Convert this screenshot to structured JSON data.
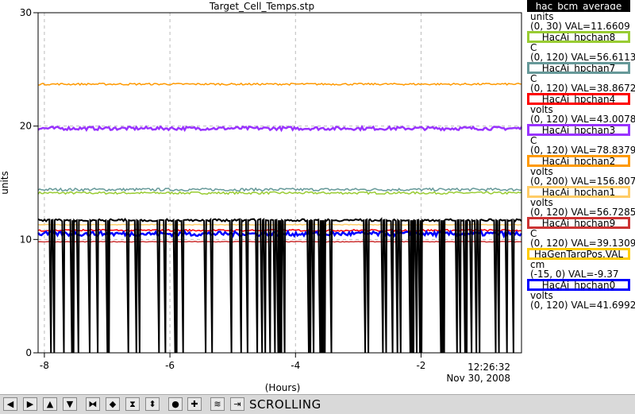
{
  "chart_data": {
    "type": "line",
    "title": "Target_Cell_Temps.stp",
    "xlabel": "(Hours)",
    "ylabel": "units",
    "xlim": [
      -8.1,
      -0.4
    ],
    "ylim": [
      0,
      30
    ],
    "xticks": [
      -8,
      -6,
      -4,
      -2
    ],
    "yticks": [
      0,
      10,
      20,
      30
    ],
    "time_label": [
      "12:26:32",
      "Nov 30, 2008"
    ],
    "grid": true,
    "legend_position": "right",
    "series": [
      {
        "name": "hac_bcm_average",
        "unit": "units",
        "range": "(0, 30)",
        "value": "VAL=11.6609",
        "color": "#000000",
        "y": 11.7,
        "noise": 0.1,
        "kind": "pulse"
      },
      {
        "name": "HacAi_hpchan8",
        "unit": "C",
        "range": "(0, 120)",
        "value": "VAL=56.6113",
        "color": "#99cc33",
        "y": 14.1,
        "noise": 0.1
      },
      {
        "name": "HacAi_hpchan7",
        "unit": "C",
        "range": "(0, 120)",
        "value": "VAL=38.8672",
        "color": "#669999",
        "y": 14.4,
        "noise": 0.12
      },
      {
        "name": "HacAi_hpchan4",
        "unit": "volts",
        "range": "(0, 120)",
        "value": "VAL=43.0078",
        "color": "#ff0000",
        "y": 10.8,
        "noise": 0.08
      },
      {
        "name": "HacAi_hpchan3",
        "unit": "C",
        "range": "(0, 120)",
        "value": "VAL=78.8379",
        "color": "#9933ff",
        "y": 19.8,
        "noise": 0.15
      },
      {
        "name": "HacAi_hpchan2",
        "unit": "volts",
        "range": "(0, 200)",
        "value": "VAL=156.807",
        "color": "#ff9900",
        "y": 23.7,
        "noise": 0.08
      },
      {
        "name": "HacAi_hpchan1",
        "unit": "volts",
        "range": "(0, 120)",
        "value": "VAL=56.7285",
        "color": "#ffcc66",
        "y": 11.3,
        "noise": 0.03
      },
      {
        "name": "HacAi_hpchan9",
        "unit": "C",
        "range": "(0, 120)",
        "value": "VAL=39.1309",
        "color": "#cc3333",
        "y": 9.8,
        "noise": 0.03
      },
      {
        "name": "HaGenTargPos.VAL",
        "unit": "cm",
        "range": "(-15, 0)",
        "value": "VAL=-9.37",
        "color": "#ffcc00",
        "y": 0,
        "noise": 0
      },
      {
        "name": "HacAi_hpchan0",
        "unit": "volts",
        "range": "(0, 120)",
        "value": "VAL=41.6992",
        "color": "#0000ff",
        "y": 10.5,
        "noise": 0.2
      }
    ]
  },
  "toolbar": {
    "buttons": [
      "arrow-left-icon",
      "arrow-right-icon",
      "arrow-up-icon",
      "arrow-down-icon",
      "zoom-in-x-icon",
      "zoom-out-x-icon",
      "zoom-in-y-icon",
      "zoom-out-y-icon",
      "circle-icon",
      "plus-icon",
      "autoscale-icon",
      "back-to-live-icon"
    ],
    "status": "SCROLLING"
  }
}
